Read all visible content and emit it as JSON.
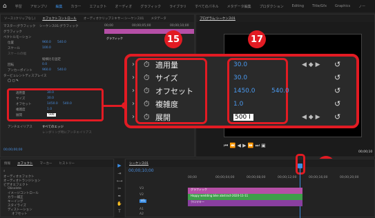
{
  "menu": {
    "home_icon": "home-icon",
    "items": [
      "学習",
      "アセンブリ",
      "編集",
      "カラー",
      "エフェクト",
      "オーディオ",
      "グラフィック",
      "ライブラリ",
      "すべてのパネル",
      "メタデータ編集",
      "プロダクション",
      "Editing",
      "Title/Gfx",
      "Graphics",
      "ノー"
    ]
  },
  "effect_controls": {
    "tabs": [
      "ソース:(クリップなし)",
      "エフェクトコントロール",
      "オーディオクリップミキサー:シーケンス01",
      "メタデータ"
    ],
    "header_seq": "マスター:グラフィック",
    "header_clip": "シーケンス01:グラフィック",
    "time1": "00;00",
    "time2": "00;00;05;00",
    "time3": "00;00;10;00",
    "clip_label": "グラフィック",
    "section_graphic": "グラフィック",
    "vector_motion": "ベクトルモーション",
    "position": "位置",
    "position_v1": "960.0",
    "position_v2": "540.0",
    "scale": "スケール",
    "scale_v": "100.0",
    "scale_width": "スケールの幅",
    "uniform_scale": "縦横比を固定",
    "rotation": "回転",
    "rotation_v": "0.0",
    "anchor": "アンカーポイント",
    "anchor_v1": "960.0",
    "anchor_v2": "540.0",
    "turbulent": "タービュレントディスプレイス",
    "small_rows": [
      {
        "label": "適用量",
        "v1": "30.0",
        "v2": ""
      },
      {
        "label": "サイズ",
        "v1": "30.0",
        "v2": ""
      },
      {
        "label": "オフセット",
        "v1": "1450.0",
        "v2": "540.0"
      },
      {
        "label": "複雑度",
        "v1": "1.0",
        "v2": ""
      },
      {
        "label": "展開",
        "v1": "500",
        "v2": ""
      }
    ],
    "antialias": "アンチエイリアス",
    "antialias_val": "すべてのエッジ",
    "antialias_opt": "レンダリング時にアンチエイリアス",
    "timecode": "00;00;00;00"
  },
  "zoom": {
    "rows": [
      {
        "label": "適用量",
        "v1": "30.0",
        "v2": ""
      },
      {
        "label": "サイズ",
        "v1": "30.0",
        "v2": ""
      },
      {
        "label": "オフセット",
        "v1": "1450.0",
        "v2": "540.0"
      },
      {
        "label": "複雑度",
        "v1": "1.0",
        "v2": ""
      },
      {
        "label": "展開",
        "v1": "500",
        "v2": ""
      }
    ]
  },
  "badges": {
    "b15": "15",
    "b16": "16",
    "b17": "17"
  },
  "program": {
    "tab": "プログラム:シーケンス01",
    "timecode": "00;00;10"
  },
  "project": {
    "tabs": [
      "情報",
      "エフェクト",
      "マーカー",
      "ヒストリー"
    ],
    "items": [
      "オーディオエフェクト",
      "オーディオトランジション",
      "ビデオエフェクト",
      "Obsolete",
      "イメージコントロール",
      "カラー補正",
      "キーイング",
      "スタイライズ",
      "ディストーション",
      "ビデオ..."
    ],
    "last_item": "オフセット"
  },
  "timeline": {
    "tab": "シーケンス01",
    "timecode": "00;00;10;00",
    "ruler": [
      "00;00",
      "00;00;04;00",
      "00;00;08;00",
      "00;00;12;00",
      "00;00;16;00",
      "00;00;20;00"
    ],
    "tracks": [
      "V3",
      "V2",
      "V1",
      "A1",
      "A2"
    ],
    "clip1": "グラフィック",
    "clip2": "Happy wedding bike abstract-2020-11-11",
    "clip3": "クロマキー"
  }
}
